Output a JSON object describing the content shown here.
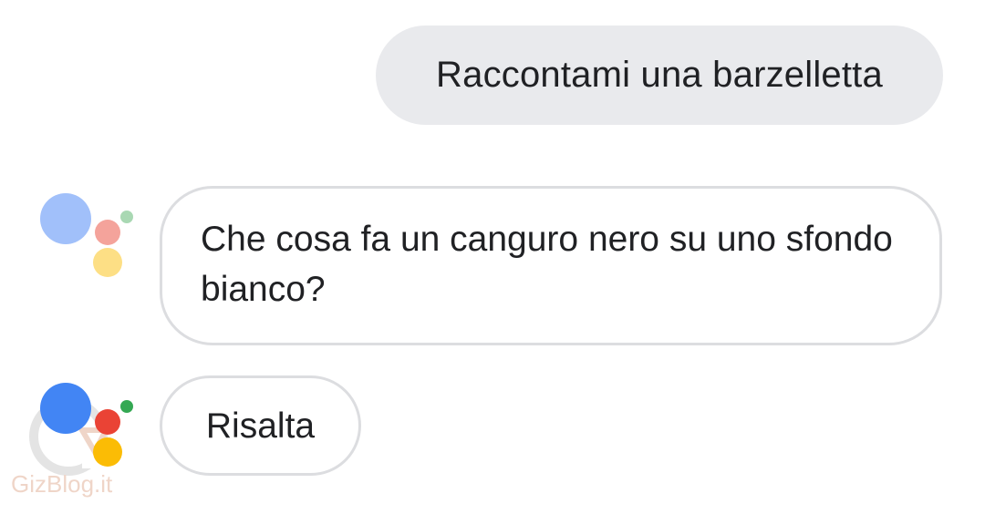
{
  "conversation": {
    "user_message": "Raccontami una barzelletta",
    "assistant_joke": "Che cosa fa un canguro nero su uno sfondo bianco?",
    "assistant_answer": "Risalta"
  },
  "assistant_logo": {
    "icon": "google-assistant-logo-icon",
    "colors": {
      "blue": "#4285f4",
      "red": "#ea4335",
      "yellow": "#fbbc05",
      "green": "#34a853",
      "faded_blue": "#a1c0fa",
      "faded_red": "#f4a39b",
      "faded_yellow": "#fddf85",
      "faded_green": "#a9d8b3"
    }
  },
  "watermark": {
    "text": "GizBlog.it"
  },
  "colors": {
    "user_bubble_bg": "#e9eaed",
    "assistant_bubble_border": "#dcdde0",
    "text": "#202124"
  }
}
